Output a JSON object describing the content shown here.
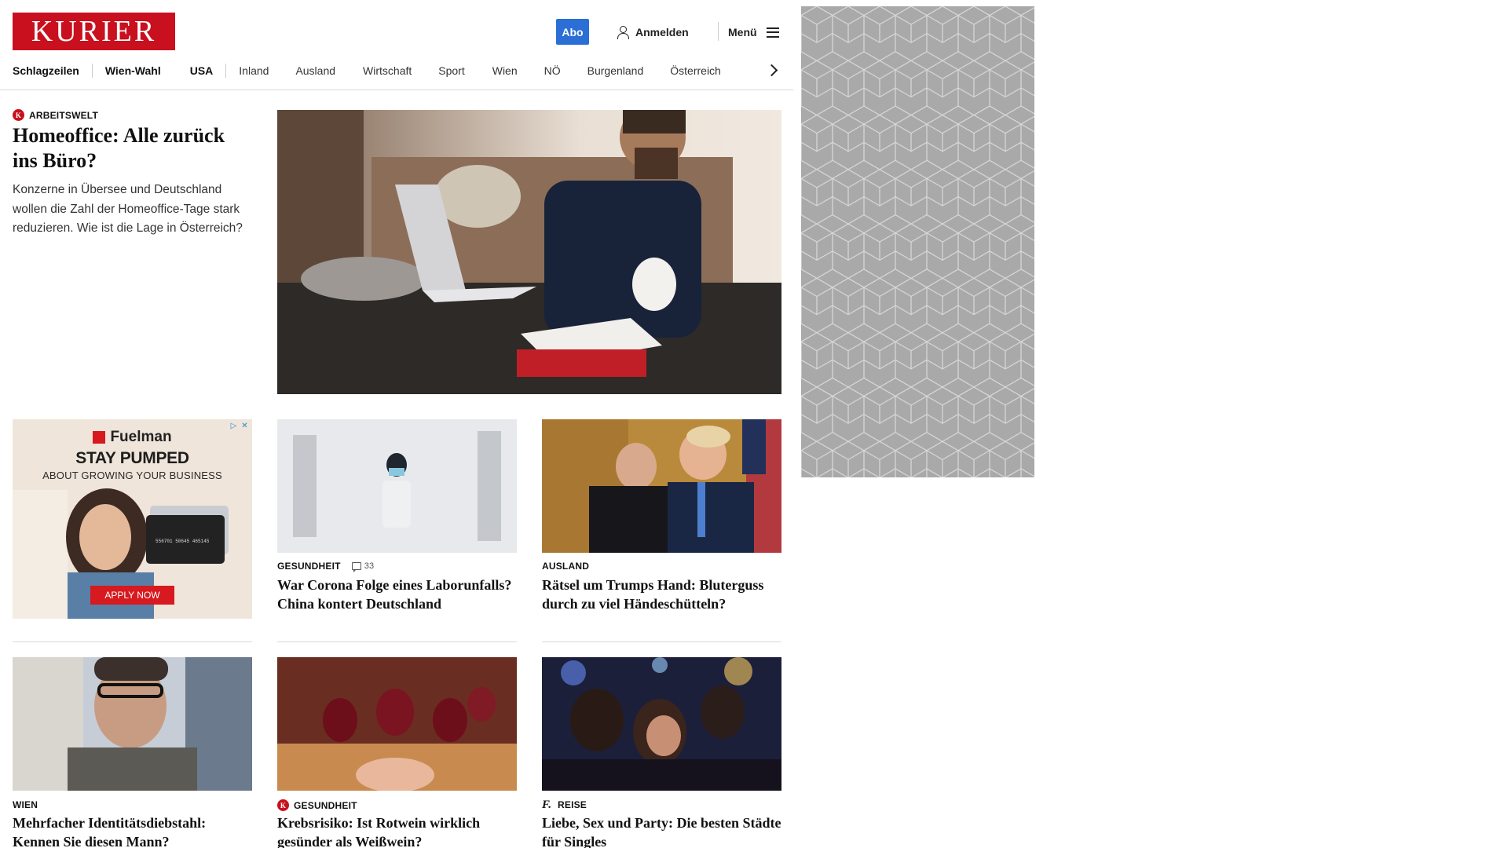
{
  "header": {
    "logo": "KURIER",
    "abo_label": "Abo",
    "login_label": "Anmelden",
    "menu_label": "Menü"
  },
  "nav": {
    "items": [
      "Schlagzeilen",
      "Wien-Wahl",
      "USA",
      "Inland",
      "Ausland",
      "Wirtschaft",
      "Sport",
      "Wien",
      "NÖ",
      "Burgenland",
      "Österreich"
    ]
  },
  "lead": {
    "kicker": "ARBEITSWELT",
    "title": "Homeoffice: Alle zurück ins Büro?",
    "teaser": "Konzerne in Übersee und Deutschland wollen die Zahl der Homeoffice-Tage stark reduzieren. Wie ist die Lage in Österreich?"
  },
  "ad": {
    "brand": "Fuelman",
    "headline": "STAY PUMPED",
    "subline": "ABOUT GROWING YOUR BUSINESS",
    "cta": "APPLY NOW",
    "card_number": "556701 50645 465145"
  },
  "cards": [
    {
      "kicker": "GESUNDHEIT",
      "comments": "33",
      "title": "War Corona Folge eines Laborunfalls? China kontert Deutschland"
    },
    {
      "kicker": "AUSLAND",
      "title": "Rätsel um Trumps Hand: Bluterguss durch zu viel Händeschütteln?"
    },
    {
      "kicker": "WIEN",
      "title": "Mehrfacher Identitätsdiebstahl: Kennen Sie diesen Mann?"
    },
    {
      "kicker": "GESUNDHEIT",
      "title": "Krebsrisiko: Ist Rotwein wirklich gesünder als Weißwein?"
    },
    {
      "kicker": "REISE",
      "title": "Liebe, Sex und Party: Die besten Städte für Singles"
    }
  ],
  "icons": {
    "kurier_k": "K",
    "freizeit_f": "f."
  },
  "colors": {
    "brand_red": "#c8101e",
    "abo_blue": "#2b6fd6",
    "rail_gray": "#a9a9a9"
  }
}
